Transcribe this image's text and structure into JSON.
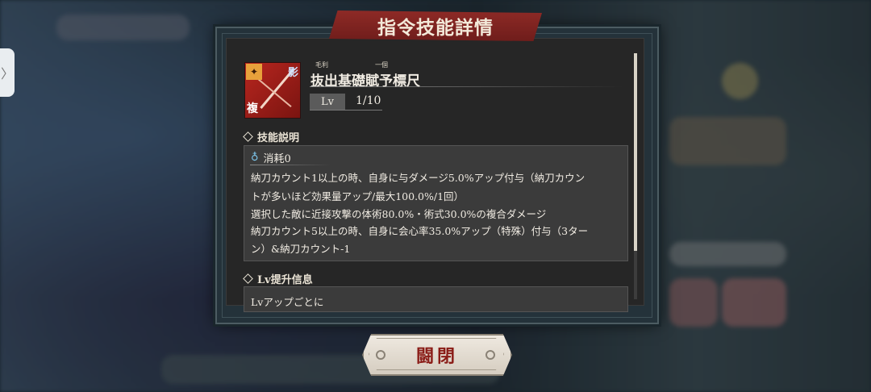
{
  "dialog": {
    "title": "指令技能詳情",
    "close_label": "闘閉"
  },
  "skill": {
    "name": "抜出基礎賦予標尺",
    "ruby_left": "毛利",
    "ruby_right": "一個",
    "icon_badge": "✦",
    "icon_corner": "影",
    "icon_type": "複",
    "lv_label": "Lv",
    "lv_value": "1/10"
  },
  "sections": {
    "description_header": "技能説明",
    "lv_header": "Lv提升信息"
  },
  "description": {
    "cost": "消耗0",
    "lines": [
      "納刀カウント1以上の時、自身に与ダメージ5.0%アップ付与（納刀カウン",
      "トが多いほど効果量アップ/最大100.0%/1回）",
      "選択した敵に近接攻撃の体術80.0%・術式30.0%の複合ダメージ",
      "納刀カウント5以上の時、自身に会心率35.0%アップ（特殊）付与（3ター",
      "ン）&納刀カウント-1"
    ]
  },
  "lv_info": {
    "text": "Lvアップごとに"
  },
  "side_tab": {
    "glyph": "〉"
  }
}
